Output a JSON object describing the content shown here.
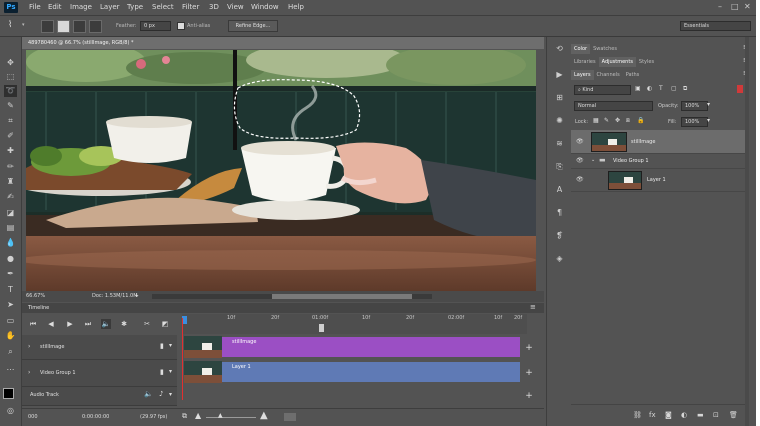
{
  "menu": {
    "logo": "Ps",
    "items": [
      "File",
      "Edit",
      "Image",
      "Layer",
      "Type",
      "Select",
      "Filter",
      "3D",
      "View",
      "Window",
      "Help"
    ]
  },
  "options_bar": {
    "feather_label": "Feather:",
    "feather_value": "0 px",
    "antialias_label": "Anti-alias",
    "refine_edge_label": "Refine Edge...",
    "workspace": "Essentials"
  },
  "document": {
    "tab_title": "489780460 @ 66.7% (stillImage, RGB/8) *",
    "zoom": "66.67%",
    "doc_size": "Doc: 1.53M/11.0M"
  },
  "timeline": {
    "title": "Timeline",
    "ruler_ticks": [
      "10f",
      "20f",
      "01:00f",
      "10f",
      "20f",
      "02:00f",
      "10f",
      "20f"
    ],
    "tracks": [
      {
        "name": "stillImage",
        "clip_label": "stillImage"
      },
      {
        "name": "Video Group 1",
        "clip_label": "Layer 1"
      }
    ],
    "audio_track": "Audio Track",
    "frame": "0:00:00:00",
    "fps": "(29.97 fps)",
    "frame_number": "000",
    "colors": {
      "clip_purple": "#9b4fc4",
      "clip_blue": "#5f7ab5",
      "playhead": "#e23030"
    }
  },
  "panels": {
    "top_tabs": [
      "Color",
      "Swatches"
    ],
    "mid_tabs": [
      "Libraries",
      "Adjustments",
      "Styles"
    ],
    "layer_tabs": [
      "Layers",
      "Channels",
      "Paths"
    ],
    "filter_kind": "Kind",
    "blend_mode": "Normal",
    "opacity_label": "Opacity:",
    "opacity_value": "100%",
    "lock_label": "Lock:",
    "fill_label": "Fill:",
    "fill_value": "100%",
    "layers": [
      {
        "name": "stillImage",
        "selected": true,
        "indent": 0
      },
      {
        "name": "Video Group 1",
        "selected": false,
        "indent": 1
      },
      {
        "name": "Layer 1",
        "selected": false,
        "indent": 2
      }
    ]
  }
}
